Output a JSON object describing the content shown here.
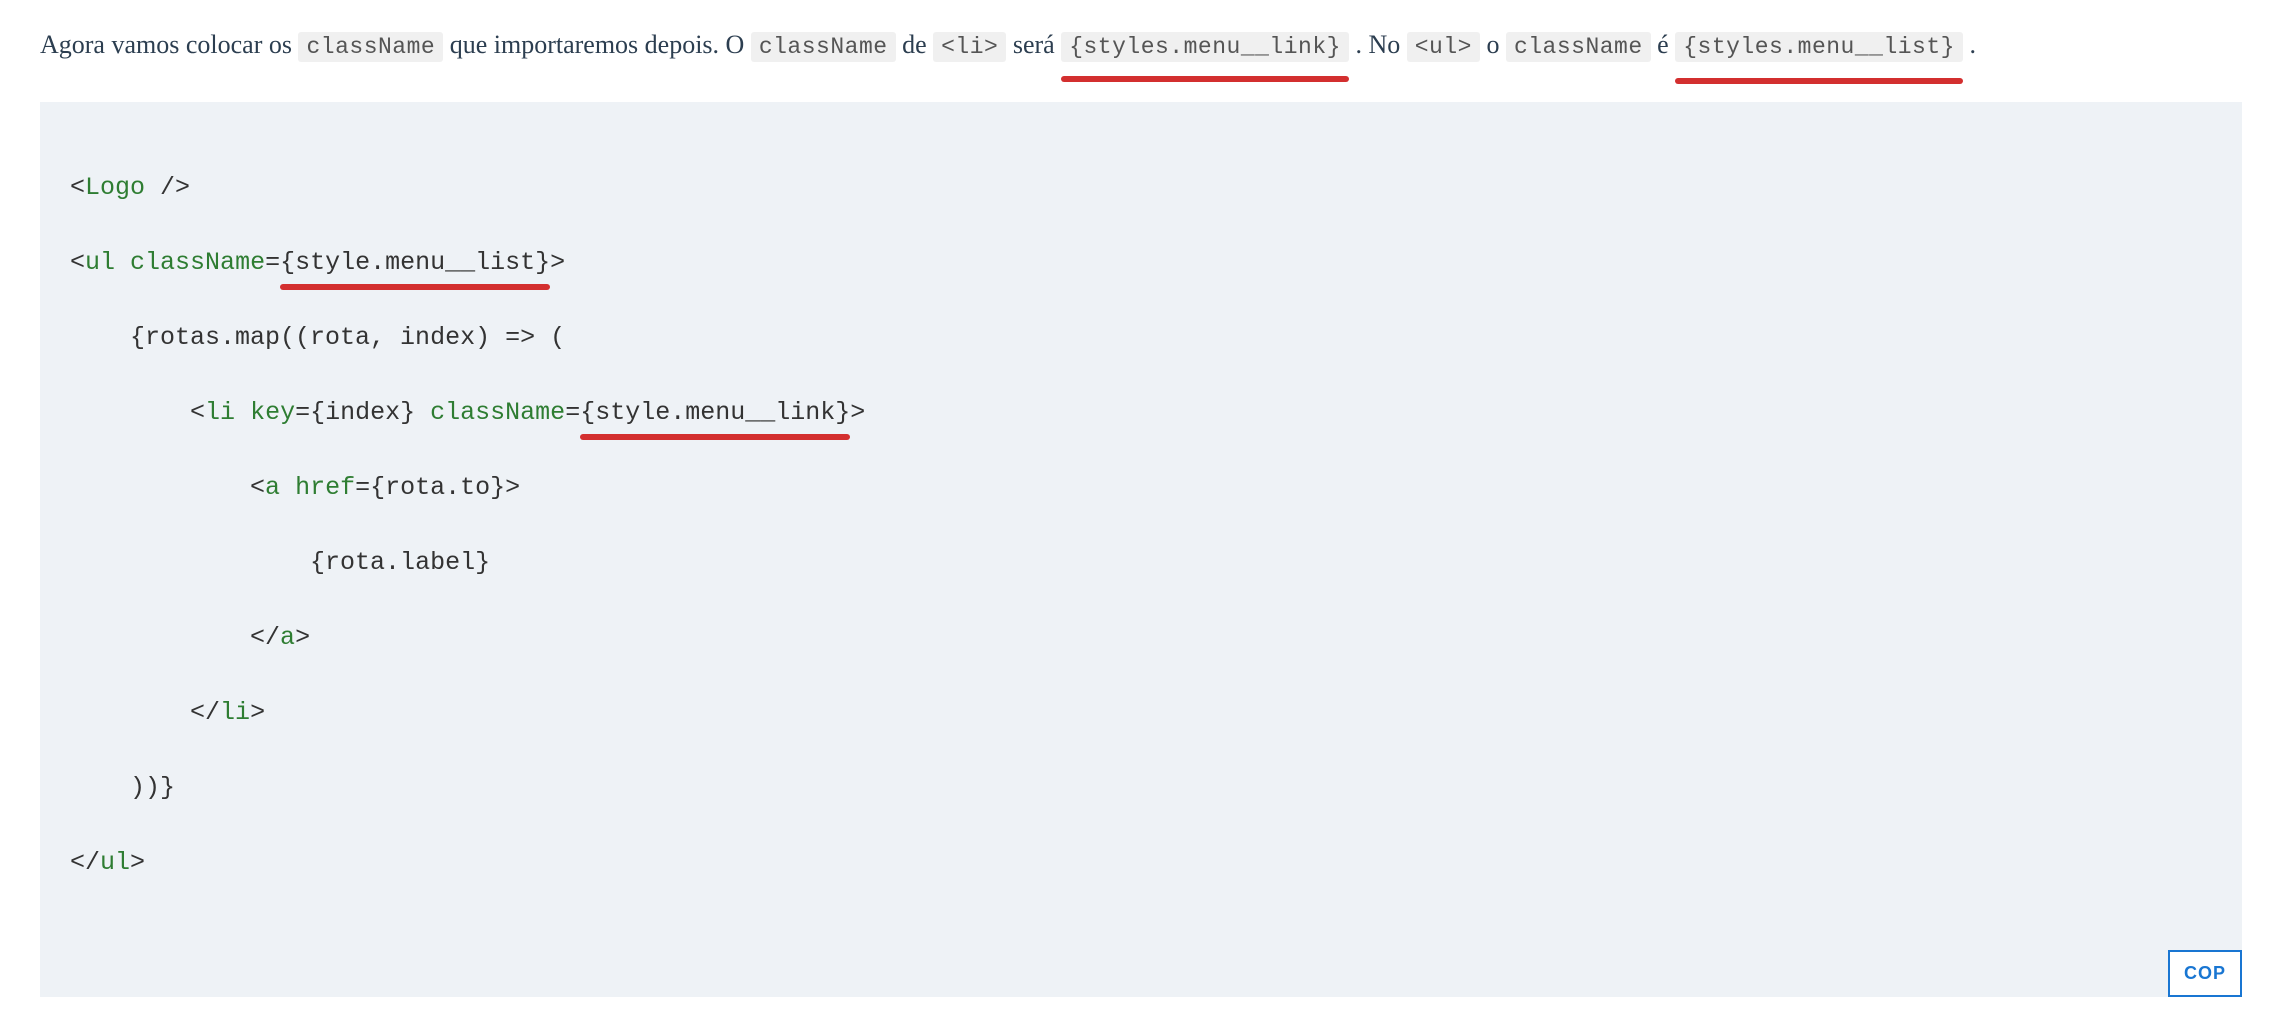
{
  "paragraph": {
    "text1": "Agora vamos colocar os ",
    "code1": "className",
    "text2": " que importaremos depois. O ",
    "code2": "className",
    "text3": " de ",
    "code3": "<li>",
    "text4": " será ",
    "code4": "{styles.menu__link}",
    "text5": ". No ",
    "code5": "<ul>",
    "text6": " o ",
    "code6": "className",
    "text7": " é ",
    "code7": "{styles.menu__list}",
    "text8": "."
  },
  "code": {
    "line1": {
      "open": "<",
      "tag": "Logo",
      "close": " />"
    },
    "line2": {
      "open": "<",
      "tag": "ul",
      "space": " ",
      "attr": "className",
      "eq": "=",
      "lbrace": "{",
      "val": "style.menu__list",
      "rbrace": "}",
      "close": ">"
    },
    "line3": {
      "indent": "    ",
      "text": "{rotas.map((rota, index) => ("
    },
    "line4": {
      "indent": "        ",
      "open": "<",
      "tag": "li",
      "space1": " ",
      "attr1": "key",
      "eq1": "=",
      "val1": "{index}",
      "space2": " ",
      "attr2": "className",
      "eq2": "=",
      "lbrace": "{",
      "val2": "style.menu__link",
      "rbrace": "}",
      "close": ">"
    },
    "line5": {
      "indent": "            ",
      "open": "<",
      "tag": "a",
      "space": " ",
      "attr": "href",
      "eq": "=",
      "val": "{rota.to}",
      "close": ">"
    },
    "line6": {
      "indent": "                ",
      "text": "{rota.label}"
    },
    "line7": {
      "indent": "            ",
      "open": "</",
      "tag": "a",
      "close": ">"
    },
    "line8": {
      "indent": "        ",
      "open": "</",
      "tag": "li",
      "close": ">"
    },
    "line9": {
      "indent": "    ",
      "text": "))}"
    },
    "line10": {
      "open": "</",
      "tag": "ul",
      "close": ">"
    }
  },
  "copy_button": "COP"
}
